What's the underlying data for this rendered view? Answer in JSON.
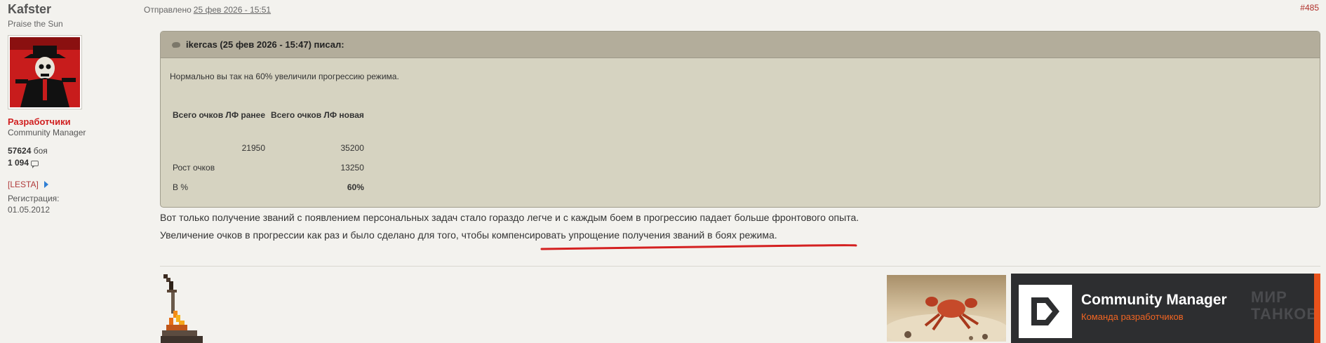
{
  "user": {
    "name": "Kafster",
    "title": "Praise the Sun",
    "group": "Разработчики",
    "role": "Community Manager",
    "battles_value": "57624",
    "battles_label": "боя",
    "posts_value": "1 094",
    "clan": "[LESTA]",
    "reg_label": "Регистрация:",
    "reg_date": "01.05.2012"
  },
  "post": {
    "sent_label": "Отправлено",
    "date": "25 фев 2026 - 15:51",
    "number": "#485",
    "text_line1": "Вот только получение званий с появлением персональных задач стало гораздо легче и с каждым боем в прогрессию падает больше фронтового опыта.",
    "text_line2": "Увеличение очков в прогрессии как раз и было сделано для того, чтобы компенсировать упрощение получения званий в боях режима."
  },
  "quote": {
    "header": "ikercas (25 фев 2026 - 15:47) писал:",
    "text": "Нормально вы так на 60% увеличили прогрессию режима.",
    "table": {
      "headers": [
        "Всего очков ЛФ ранее",
        "Всего очков ЛФ новая"
      ],
      "row_values": [
        "21950",
        "35200"
      ],
      "growth_label": "Рост очков",
      "growth_value": "13250",
      "percent_label": "В %",
      "percent_value": "60%"
    }
  },
  "signature": {
    "banner_title": "Community Manager",
    "banner_subtitle": "Команда разработчиков",
    "banner_watermark_1": "МИР",
    "banner_watermark_2": "ТАНКОВ"
  },
  "colors": {
    "background": "#f3f2ee",
    "group_red": "#d01f1f",
    "quote_bg": "#d6d3c1",
    "quote_header": "#b3ad9b",
    "accent_orange": "#f26522",
    "annotation_red": "#d42020"
  },
  "icons": {
    "posts": "speech-bubble-icon",
    "clan": "arrow-right-icon",
    "quote": "quote-bubble-icon"
  }
}
